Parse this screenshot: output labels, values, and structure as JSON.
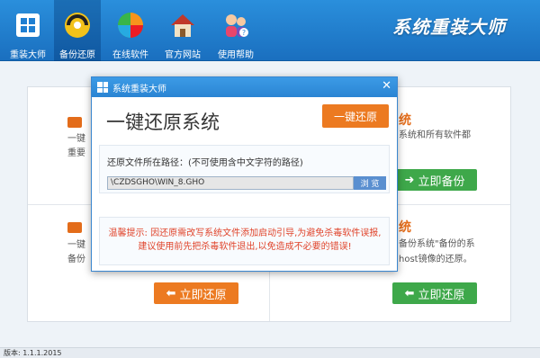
{
  "nav": [
    {
      "label": "重装大师",
      "icon": "windows-icon"
    },
    {
      "label": "备份还原",
      "icon": "backup-disc-icon",
      "active": true
    },
    {
      "label": "在线软件",
      "icon": "software-pie-icon"
    },
    {
      "label": "官方网站",
      "icon": "home-icon"
    },
    {
      "label": "使用帮助",
      "icon": "help-people-icon"
    }
  ],
  "brand": "系统重装大师",
  "cards": {
    "backup": {
      "title": "统",
      "text_line1": "系统和所有软件都",
      "button": "立即备份"
    },
    "restore_left": {
      "text_line1": "一键",
      "text_line2": "备份",
      "button": "立即还原"
    },
    "ghost": {
      "title": "统",
      "text_line1": "备份系统\"备份的系",
      "text_line2": "host镜像的还原。",
      "button": "立即还原"
    },
    "left_top": {
      "text_line1": "一键",
      "text_line2": "重要"
    }
  },
  "dialog": {
    "title": "系统重装大师",
    "heading": "一键还原系统",
    "restore_button": "一键还原",
    "path_label": "还原文件所在路径：(不可使用含中文字符的路径)",
    "path_value": "\\CZDSGHO\\WIN_8.GHO",
    "browse": "浏 览",
    "warning": "温馨提示: 因还原需改写系统文件添加启动引导,为避免杀毒软件误报,建议使用前先把杀毒软件退出,以免造成不必要的错误!"
  },
  "status": "版本: 1.1.1.2015",
  "colors": {
    "primary": "#1a6fbf",
    "orange": "#ec7a21",
    "green": "#3ea84a",
    "warning": "#e0442b"
  }
}
